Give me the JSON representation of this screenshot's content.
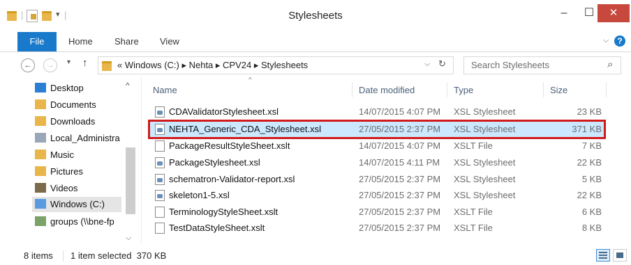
{
  "window": {
    "title": "Stylesheets",
    "minimize": "–",
    "maximize": "☐",
    "close": "✕"
  },
  "ribbon": {
    "tabs": [
      "File",
      "Home",
      "Share",
      "View"
    ],
    "help": "?",
    "expand": "⌵"
  },
  "address": {
    "back": "←",
    "forward": "→",
    "recent": "▾",
    "up": "↑",
    "path": "« Windows (C:) ▸ Nehta ▸ CPV24 ▸ Stylesheets",
    "dropdown": "⌵",
    "refresh": "↻"
  },
  "search": {
    "placeholder": "Search Stylesheets",
    "icon": "⌕"
  },
  "nav": {
    "items": [
      "Desktop",
      "Documents",
      "Downloads",
      "Local_Administra",
      "Music",
      "Pictures",
      "Videos",
      "Windows (C:)",
      "groups (\\\\bne-fp"
    ],
    "selected": "Windows (C:)"
  },
  "columns": {
    "name": "Name",
    "date": "Date modified",
    "type": "Type",
    "size": "Size",
    "sort": "^"
  },
  "files": [
    {
      "name": "CDAValidatorStylesheet.xsl",
      "date": "14/07/2015 4:07 PM",
      "type": "XSL Stylesheet",
      "size": "23 KB",
      "icon": "xsl-file-icon"
    },
    {
      "name": "NEHTA_Generic_CDA_Stylesheet.xsl",
      "date": "27/05/2015 2:37 PM",
      "type": "XSL Stylesheet",
      "size": "371 KB",
      "icon": "xsl-file-icon",
      "selected": true
    },
    {
      "name": "PackageResultStyleSheet.xslt",
      "date": "14/07/2015 4:07 PM",
      "type": "XSLT File",
      "size": "7 KB",
      "icon": "file-icon"
    },
    {
      "name": "PackageStylesheet.xsl",
      "date": "14/07/2015 4:11 PM",
      "type": "XSL Stylesheet",
      "size": "22 KB",
      "icon": "xsl-file-icon"
    },
    {
      "name": "schematron-Validator-report.xsl",
      "date": "27/05/2015 2:37 PM",
      "type": "XSL Stylesheet",
      "size": "5 KB",
      "icon": "xsl-file-icon"
    },
    {
      "name": "skeleton1-5.xsl",
      "date": "27/05/2015 2:37 PM",
      "type": "XSL Stylesheet",
      "size": "22 KB",
      "icon": "xsl-file-icon"
    },
    {
      "name": "TerminologyStyleSheet.xslt",
      "date": "27/05/2015 2:37 PM",
      "type": "XSLT File",
      "size": "6 KB",
      "icon": "file-icon"
    },
    {
      "name": "TestDataStyleSheet.xslt",
      "date": "27/05/2015 2:37 PM",
      "type": "XSLT File",
      "size": "8 KB",
      "icon": "file-icon"
    }
  ],
  "status": {
    "count": "8 items",
    "selection": "1 item selected  370 KB"
  },
  "colors": {
    "accent": "#1979ca",
    "close": "#c7483c",
    "selection": "#cce8ff",
    "highlight": "#d21a1a"
  }
}
